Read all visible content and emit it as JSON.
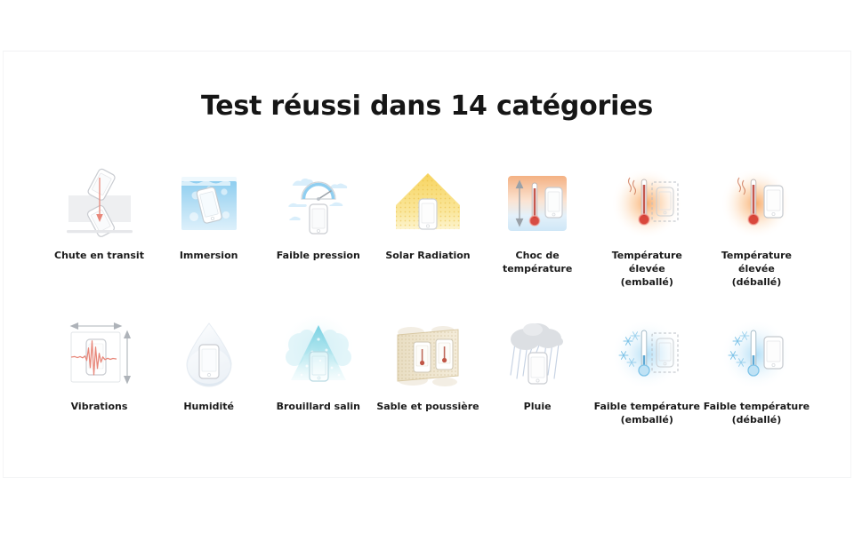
{
  "page": {
    "background_color": "#ffffff",
    "card_border_color": "#f4f5f6"
  },
  "header": {
    "title": "Test réussi dans 14 catégories",
    "title_color": "#161616"
  },
  "grid": {
    "rows": [
      {
        "cells": [
          {
            "icon": "drop-test-icon",
            "label": "Chute en transit"
          },
          {
            "icon": "immersion-icon",
            "label": "Immersion"
          },
          {
            "icon": "low-pressure-gauge-icon",
            "label": "Faible pression"
          },
          {
            "icon": "solar-radiation-icon",
            "label": "Solar Radiation"
          },
          {
            "icon": "thermal-shock-icon",
            "label": "Choc de\ntempérature"
          },
          {
            "icon": "high-temp-packed-icon",
            "label": "Température élevée\n(emballé)"
          },
          {
            "icon": "high-temp-unpacked-icon",
            "label": "Température élevée\n(déballé)"
          }
        ]
      },
      {
        "cells": [
          {
            "icon": "vibration-icon",
            "label": "Vibrations"
          },
          {
            "icon": "humidity-droplet-icon",
            "label": "Humidité"
          },
          {
            "icon": "salt-fog-icon",
            "label": "Brouillard salin"
          },
          {
            "icon": "sand-dust-icon",
            "label": "Sable et poussière"
          },
          {
            "icon": "rain-cloud-icon",
            "label": "Pluie"
          },
          {
            "icon": "low-temp-packed-icon",
            "label": "Faible température\n(emballé)"
          },
          {
            "icon": "low-temp-unpacked-icon",
            "label": "Faible température\n(déballé)"
          }
        ]
      }
    ]
  },
  "colors": {
    "phone_outline": "#c9ccd1",
    "arrow_red": "#e8877a",
    "water_blue": "#9fd4f2",
    "solar_yellow": "#f6d365",
    "hot_orange": "#f3a26a",
    "cold_blue": "#bfe2f5",
    "sand_tan": "#e5d8bc",
    "rain_gray": "#d7dade",
    "mercury_red": "#d63a2f"
  }
}
